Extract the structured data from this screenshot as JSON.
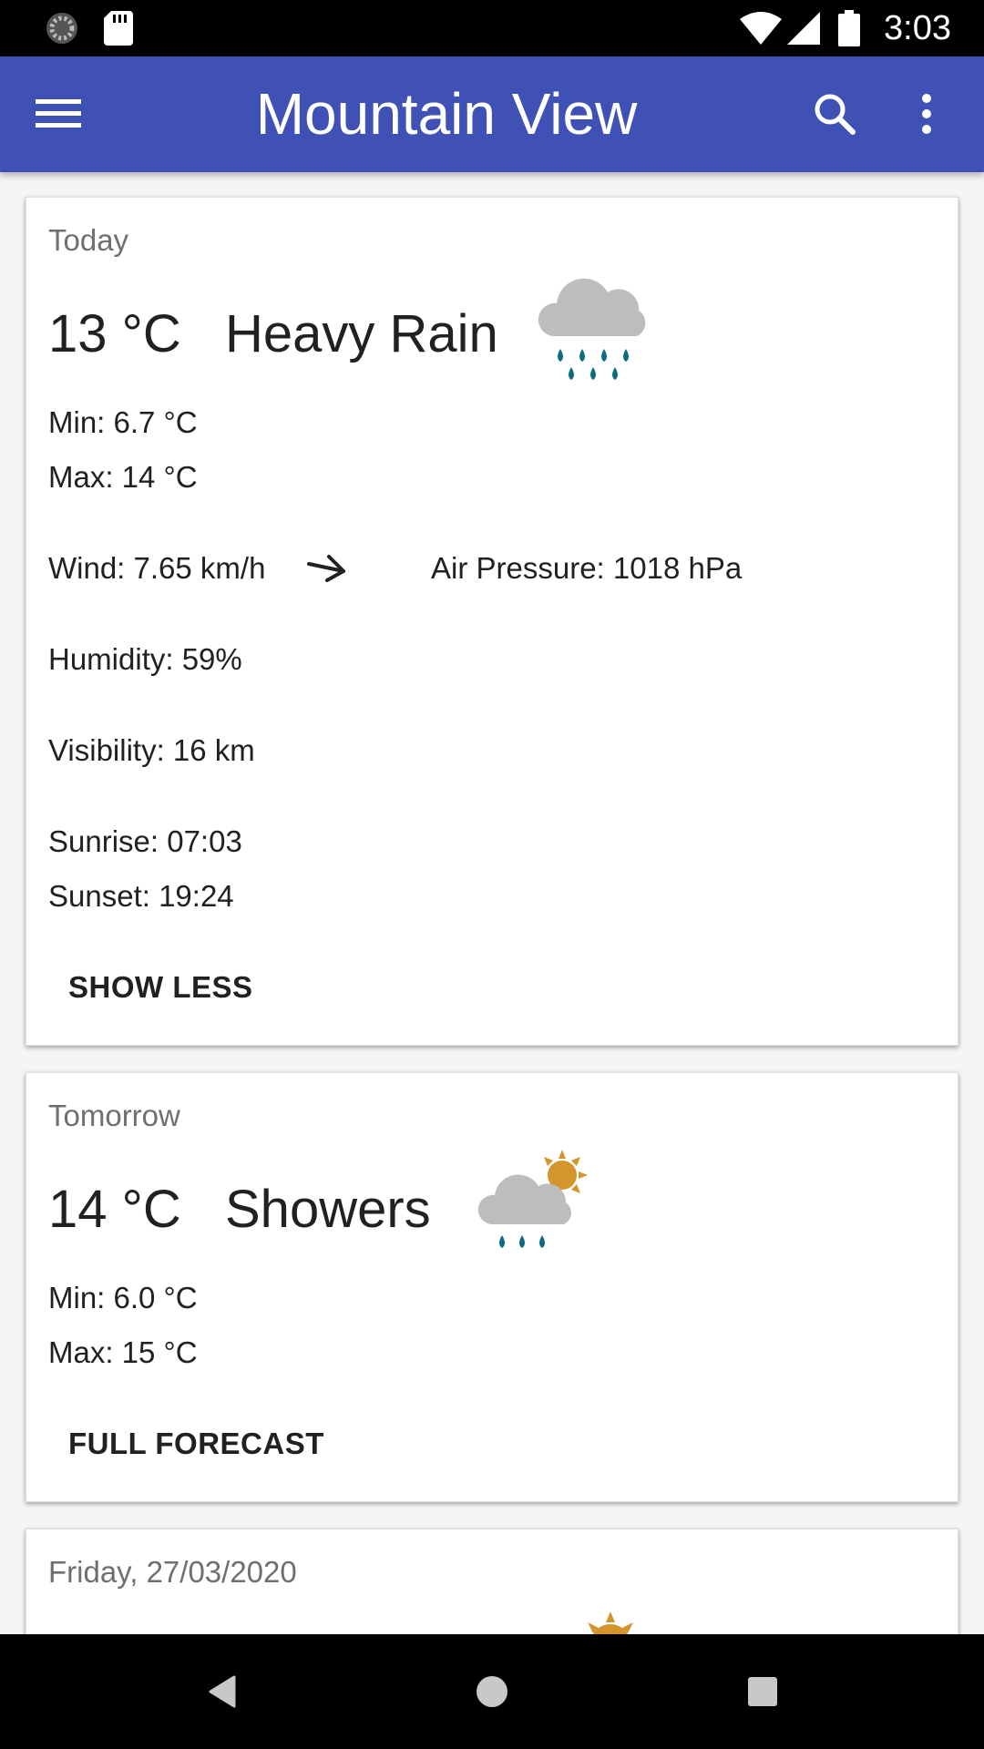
{
  "status_bar": {
    "time": "3:03",
    "icons": [
      "sync-icon",
      "sd-card-icon",
      "wifi-icon",
      "signal-icon",
      "battery-icon"
    ]
  },
  "app_bar": {
    "title": "Mountain View",
    "icons": [
      "menu-icon",
      "search-icon",
      "more-vert-icon"
    ],
    "color": "#3f51b5"
  },
  "cards": [
    {
      "date": "Today",
      "temperature": "13 °C",
      "description": "Heavy Rain",
      "icon": "heavy-rain-icon",
      "min": "Min: 6.7 °C",
      "max": "Max: 14 °C",
      "wind": "Wind: 7.65 km/h",
      "wind_icon": "wind-direction-arrow-icon",
      "air_pressure": "Air Pressure: 1018 hPa",
      "humidity": "Humidity: 59%",
      "visibility": "Visibility: 16 km",
      "sunrise": "Sunrise: 07:03",
      "sunset": "Sunset: 19:24",
      "button": "SHOW LESS"
    },
    {
      "date": "Tomorrow",
      "temperature": "14 °C",
      "description": "Showers",
      "icon": "showers-sun-icon",
      "min": "Min: 6.0 °C",
      "max": "Max: 15 °C",
      "button": "FULL FORECAST"
    },
    {
      "date": "Friday, 27/03/2020",
      "icon": "sun-icon"
    }
  ],
  "nav_bar": {
    "icons": [
      "back-icon",
      "home-icon",
      "recents-icon"
    ]
  },
  "colors": {
    "rain_drop": "#0e6a80",
    "cloud": "#bdbdbd",
    "sun": "#d4952b"
  }
}
